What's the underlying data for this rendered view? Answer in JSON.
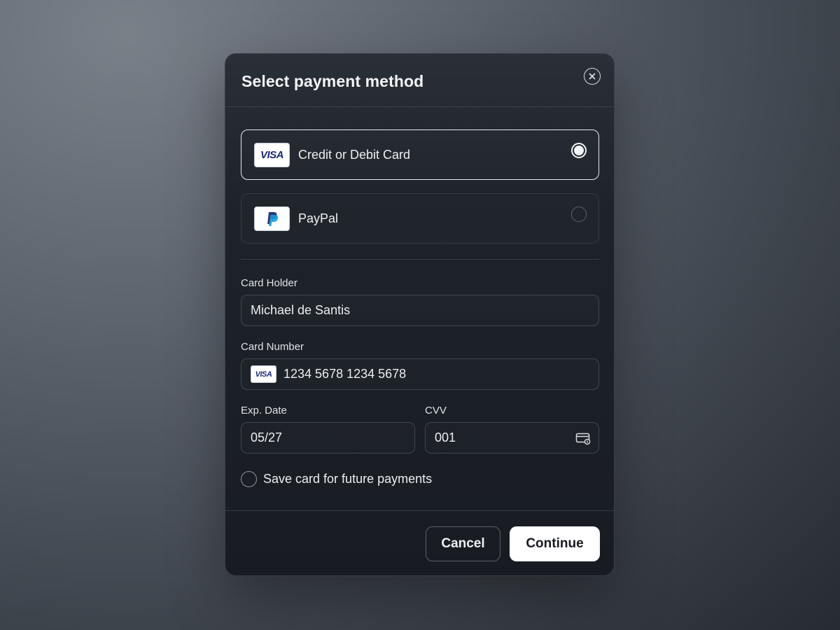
{
  "modal": {
    "title": "Select payment method",
    "close_icon": "close-icon"
  },
  "payment_options": [
    {
      "label": "Credit or Debit Card",
      "logo_text": "VISA",
      "icon": "visa-logo",
      "selected": true
    },
    {
      "label": "PayPal",
      "logo_text": "",
      "icon": "paypal-logo",
      "selected": false
    }
  ],
  "form": {
    "card_holder": {
      "label": "Card Holder",
      "value": "Michael de Santis"
    },
    "card_number": {
      "label": "Card Number",
      "value": "1234 5678 1234 5678",
      "brand": "VISA"
    },
    "exp_date": {
      "label": "Exp. Date",
      "value": "05/27"
    },
    "cvv": {
      "label": "CVV",
      "value": "001",
      "icon": "card-lock-icon"
    },
    "save_card": {
      "label": "Save card for future payments",
      "checked": false
    }
  },
  "footer": {
    "cancel_label": "Cancel",
    "continue_label": "Continue"
  },
  "colors": {
    "visa_blue": "#1a2a78",
    "paypal_dark": "#253b80",
    "paypal_light": "#179bd7",
    "primary_button_bg": "#ffffff"
  }
}
